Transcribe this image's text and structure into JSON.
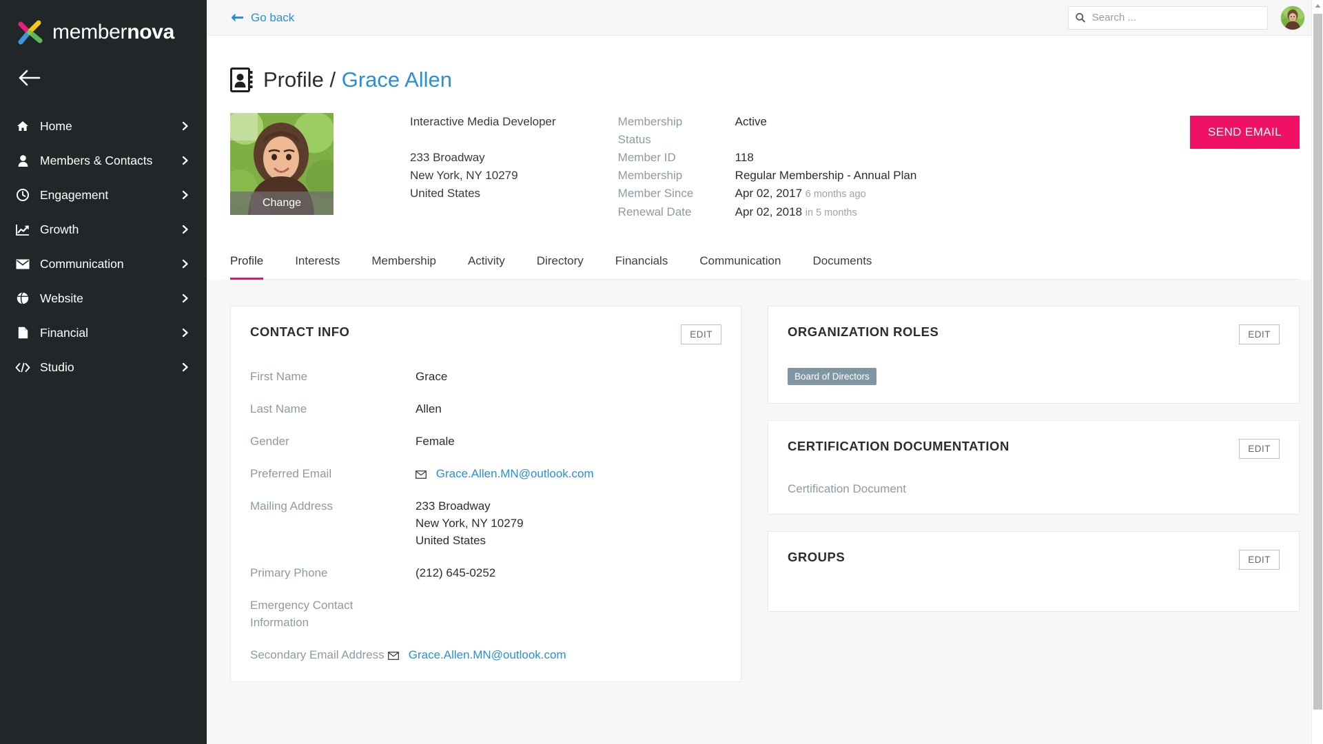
{
  "brand": {
    "name_light": "member",
    "name_bold": "nova",
    "logo_colors": [
      "#ec1c7d",
      "#f5c518",
      "#5bb85b",
      "#3a9ad9"
    ],
    "accent_pink": "#ef1164",
    "link_blue": "#2a8fd4",
    "sidebar_bg": "#212628",
    "tag_gray": "#8196a3"
  },
  "sidebar": {
    "back_icon": "arrow-left-icon",
    "items": [
      {
        "label": "Home",
        "icon": "home-icon"
      },
      {
        "label": "Members & Contacts",
        "icon": "user-icon"
      },
      {
        "label": "Engagement",
        "icon": "clock-icon"
      },
      {
        "label": "Growth",
        "icon": "chart-line-icon"
      },
      {
        "label": "Communication",
        "icon": "envelope-icon"
      },
      {
        "label": "Website",
        "icon": "globe-icon"
      },
      {
        "label": "Financial",
        "icon": "file-icon"
      },
      {
        "label": "Studio",
        "icon": "code-icon"
      }
    ]
  },
  "topbar": {
    "go_back": "Go back",
    "search": {
      "value": "",
      "placeholder": "Search ..."
    }
  },
  "page": {
    "title_prefix": "Profile",
    "title_separator": "/",
    "title_name": "Grace Allen"
  },
  "profile_header": {
    "photo_change_label": "Change",
    "job_title": "Interactive Media Developer",
    "address_line1": "233 Broadway",
    "address_line2": "New York, NY 10279",
    "address_line3": "United States",
    "meta": [
      {
        "key": "Membership Status",
        "value": "Active",
        "note": ""
      },
      {
        "key": "Member ID",
        "value": "118",
        "note": ""
      },
      {
        "key": "Membership",
        "value": "Regular Membership - Annual Plan",
        "note": ""
      },
      {
        "key": "Member Since",
        "value": "Apr 02, 2017",
        "note": "6 months ago"
      },
      {
        "key": "Renewal Date",
        "value": "Apr 02, 2018",
        "note": "in 5 months"
      }
    ],
    "send_email_label": "SEND EMAIL"
  },
  "tabs": [
    {
      "label": "Profile",
      "active": true
    },
    {
      "label": "Interests",
      "active": false
    },
    {
      "label": "Membership",
      "active": false
    },
    {
      "label": "Activity",
      "active": false
    },
    {
      "label": "Directory",
      "active": false
    },
    {
      "label": "Financials",
      "active": false
    },
    {
      "label": "Communication",
      "active": false
    },
    {
      "label": "Documents",
      "active": false
    }
  ],
  "contact_info": {
    "title": "CONTACT INFO",
    "edit_label": "EDIT",
    "fields": [
      {
        "key": "First Name",
        "value": "Grace",
        "type": "text"
      },
      {
        "key": "Last Name",
        "value": "Allen",
        "type": "text"
      },
      {
        "key": "Gender",
        "value": "Female",
        "type": "text"
      },
      {
        "key": "Preferred Email",
        "value": "Grace.Allen.MN@outlook.com",
        "type": "email"
      },
      {
        "key": "Mailing Address",
        "value": "233 Broadway\nNew York, NY  10279\nUnited States",
        "type": "multiline"
      },
      {
        "key": "Primary Phone",
        "value": "(212) 645-0252",
        "type": "text"
      },
      {
        "key": "Emergency Contact Information",
        "value": "",
        "type": "text"
      },
      {
        "key": "Secondary Email Address",
        "value": "Grace.Allen.MN@outlook.com",
        "type": "email"
      }
    ]
  },
  "organization_roles": {
    "title": "ORGANIZATION ROLES",
    "edit_label": "EDIT",
    "roles": [
      "Board of Directors"
    ]
  },
  "certification": {
    "title": "CERTIFICATION DOCUMENTATION",
    "edit_label": "EDIT",
    "item": "Certification Document"
  },
  "groups": {
    "title": "GROUPS",
    "edit_label": "EDIT"
  }
}
